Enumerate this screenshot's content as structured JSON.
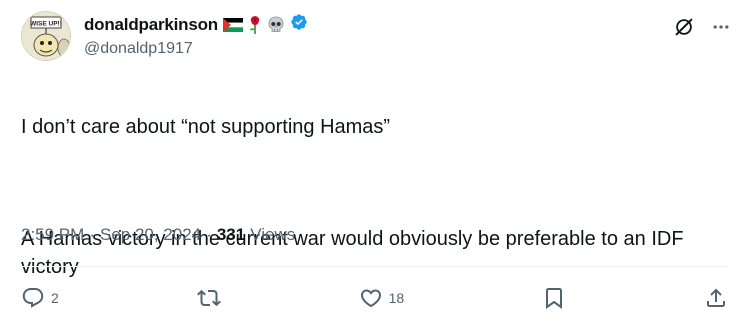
{
  "tweet": {
    "display_name": "donaldparkinson",
    "name_emojis": [
      "palestine-flag",
      "rose",
      "skull"
    ],
    "handle": "@donaldp1917",
    "verified": true,
    "text_line1": "I don’t care about “not supporting Hamas”",
    "text_line2": "A Hamas victory in the current war would obviously be preferable to an IDF victory",
    "time": "2:59 PM",
    "sep1": "·",
    "date": "Sep 20, 2024",
    "sep2": "·",
    "views_count": "331",
    "views_label": "Views",
    "reply_count": "2",
    "like_count": "18",
    "avatar_sign_text": "WISE UP!!"
  },
  "colors": {
    "text": "#0f1419",
    "muted": "#536471",
    "verified": "#1d9bf0",
    "divider": "#eff3f4"
  },
  "icons": {
    "grok": "grok-icon",
    "more": "more-icon",
    "reply": "reply-icon",
    "retweet": "retweet-icon",
    "like": "like-icon",
    "bookmark": "bookmark-icon",
    "share": "share-icon"
  }
}
